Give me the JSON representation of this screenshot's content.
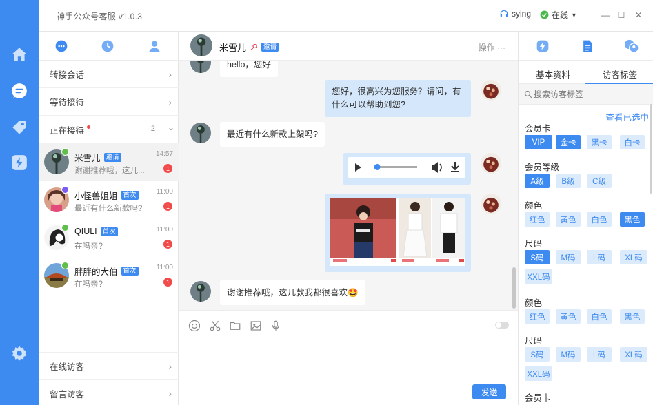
{
  "app": {
    "title": "神手公众号客服 v1.0.3",
    "username": "sying",
    "status": "在线",
    "accent": "#3d8af0"
  },
  "window": {
    "minimize": "—",
    "maximize": "☐",
    "close": "✕"
  },
  "rail": {
    "icons": [
      "home-icon",
      "chat-bubble-icon",
      "tag-icon",
      "lightning-icon",
      "settings-gear-icon"
    ]
  },
  "list": {
    "tabs": [
      "chat-tab-icon",
      "history-clock-icon",
      "contacts-person-icon"
    ],
    "transfer": "转接会话",
    "waiting": "等待接待",
    "serving": "正在接待",
    "serving_count": "2",
    "online_visitors": "在线访客",
    "message_visitors": "留言访客",
    "sessions": [
      {
        "name": "米雪儿",
        "tag": "邀请",
        "preview": "谢谢推荐哦，这几...",
        "time": "14:57",
        "badge": "1"
      },
      {
        "name": "小怪兽姐姐",
        "tag": "首次",
        "preview": "最近有什么新款吗?",
        "time": "11:00",
        "badge": "1"
      },
      {
        "name": "QIULI",
        "tag": "首次",
        "preview": "在吗亲?",
        "time": "11:00",
        "badge": "1"
      },
      {
        "name": "胖胖的大伯",
        "tag": "首次",
        "preview": "在吗亲?",
        "time": "11:00",
        "badge": "1"
      }
    ]
  },
  "chat": {
    "name": "米雪儿",
    "tag": "邀请",
    "ops": "操作 ···",
    "messages": {
      "m0": "hello，您好",
      "m1": "您好，很高兴为您服务？请问，有什么可以帮助到您?",
      "m2": "最近有什么新款上架吗?",
      "m5": "谢谢推荐哦，这几款我都很喜欢🤩"
    },
    "audio_progress": 0.0,
    "send": "发送"
  },
  "right": {
    "tab_info": "基本资料",
    "tab_tags": "访客标签",
    "search_placeholder": "搜索访客标签",
    "view_selected": "查看已选中",
    "groups": [
      {
        "title": "会员卡",
        "chips": [
          "VIP",
          "金卡",
          "黑卡",
          "白卡"
        ],
        "selected": [
          "VIP",
          "金卡"
        ]
      },
      {
        "title": "会员等级",
        "chips": [
          "A级",
          "B级",
          "C级"
        ],
        "selected": [
          "A级"
        ]
      },
      {
        "title": "颜色",
        "chips": [
          "红色",
          "黄色",
          "白色",
          "黑色"
        ],
        "selected": [
          "黑色"
        ]
      },
      {
        "title": "尺码",
        "chips": [
          "S码",
          "M码",
          "L码",
          "XL码",
          "XXL码"
        ],
        "selected": [
          "S码"
        ]
      },
      {
        "title": "颜色",
        "chips": [
          "红色",
          "黄色",
          "白色",
          "黑色"
        ],
        "selected": []
      },
      {
        "title": "尺码",
        "chips": [
          "S码",
          "M码",
          "L码",
          "XL码",
          "XXL码"
        ],
        "selected": []
      },
      {
        "title": "会员卡",
        "chips": [],
        "selected": []
      }
    ]
  }
}
